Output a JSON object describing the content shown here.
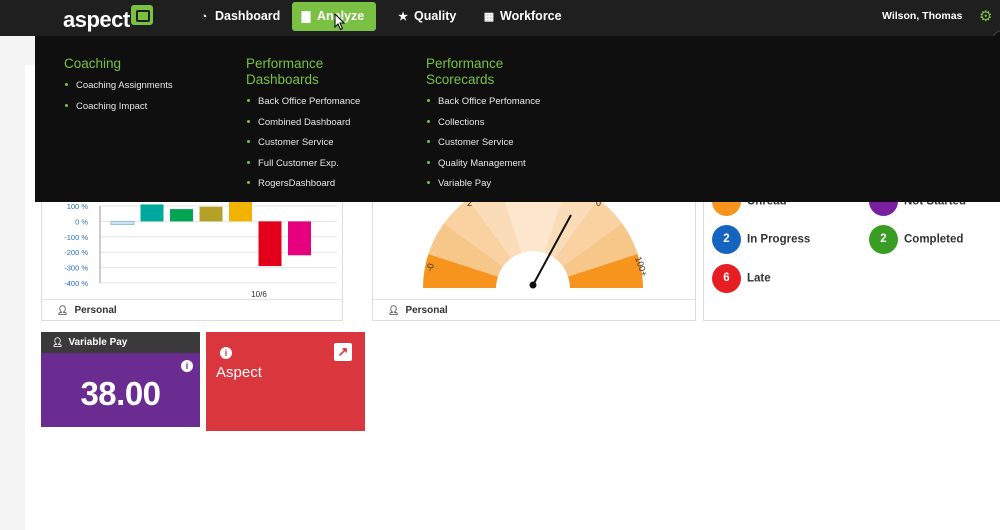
{
  "app": {
    "logo_text": "aspect"
  },
  "nav": {
    "items": [
      {
        "label": "Dashboard",
        "icon": "dashboard-icon"
      },
      {
        "label": "Analyze",
        "icon": "bar-chart-icon",
        "active": true
      },
      {
        "label": "Quality",
        "icon": "star-icon"
      },
      {
        "label": "Workforce",
        "icon": "calendar-icon"
      }
    ],
    "user_name": "Wilson, Thomas"
  },
  "menu": {
    "coaching": {
      "title": "Coaching",
      "items": [
        "Coaching Assignments",
        "Coaching Impact"
      ]
    },
    "performance_dashboards": {
      "title_line1": "Performance",
      "title_line2": "Dashboards",
      "items": [
        "Back Office Perfomance",
        "Combined Dashboard",
        "Customer Service",
        "Full Customer Exp.",
        "RogersDashboard"
      ]
    },
    "performance_scorecards": {
      "title_line1": "Performance",
      "title_line2": "Scorecards",
      "items": [
        "Back Office Perfomance",
        "Collections",
        "Customer Service",
        "Quality Management",
        "Variable Pay"
      ]
    }
  },
  "bar_panel": {
    "footer": "Personal",
    "x_tick": "10/6",
    "y_ticks": [
      "100 %",
      "0 %",
      "-100 %",
      "-200 %",
      "-300 %",
      "-400 %"
    ]
  },
  "gauge_panel": {
    "footer": "Personal",
    "labels": [
      "-0",
      "2",
      "0",
      "100+"
    ]
  },
  "status_panel": {
    "items": [
      {
        "label": "Unread",
        "count": "",
        "color": "#f7941d"
      },
      {
        "label": "Not Started",
        "count": "",
        "color": "#7b1fa2"
      },
      {
        "label": "In Progress",
        "count": "2",
        "color": "#1565c0"
      },
      {
        "label": "Completed",
        "count": "2",
        "color": "#3a9d23"
      },
      {
        "label": "Late",
        "count": "6",
        "color": "#e61e24"
      }
    ]
  },
  "variable_pay": {
    "title": "Variable Pay",
    "value": "38.00"
  },
  "aspect_tile": {
    "title": "Aspect"
  },
  "colors": {
    "accent": "#7ac143",
    "purple_tile": "#6a2c91",
    "red_tile": "#d9363e"
  },
  "chart_data": {
    "type": "bar",
    "categories": [
      "10/6"
    ],
    "series": [
      {
        "values": [
          -20
        ]
      },
      {
        "values": [
          110
        ]
      },
      {
        "values": [
          80
        ]
      },
      {
        "values": [
          95
        ]
      },
      {
        "values": [
          140
        ]
      },
      {
        "values": [
          -290
        ]
      },
      {
        "values": [
          -220
        ]
      }
    ],
    "series_colors": [
      "#cfe2f3",
      "#00a99d",
      "#00a651",
      "#b5a125",
      "#f2b200",
      "#e2001a",
      "#e6007e"
    ],
    "ylim": [
      -400,
      100
    ],
    "grid": true
  }
}
